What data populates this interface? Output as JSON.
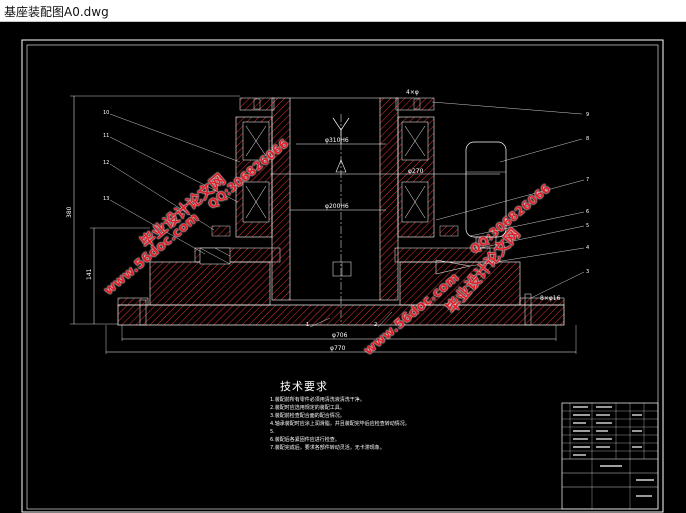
{
  "window": {
    "title": "基座装配图A0.dwg"
  },
  "drawing": {
    "dimensions": {
      "d_top": "φ310H6",
      "d_mid": "φ270",
      "d_inner": "φ200H6",
      "d_base1": "φ706",
      "d_base2": "φ770",
      "h_total": "380",
      "h_side": "141",
      "top_right": "4×φ",
      "bottom_right": "8×φ16"
    },
    "part_numbers": {
      "left": [
        "10",
        "11",
        "12",
        "13"
      ],
      "right": [
        "9",
        "8",
        "7",
        "6",
        "5",
        "4",
        "3"
      ],
      "bottom": [
        "1",
        "2"
      ]
    }
  },
  "technical_requirements": {
    "heading": "技术要求",
    "items": [
      "1.装配前所有零件必须用清洗液清洗干净。",
      "2.装配时应选用规定的装配工具。",
      "3.装配前检查配合面的配合情况。",
      "4.轴承装配时应涂上润滑脂，并且装配完毕后应检查转动情况。",
      "5.",
      "6.装配后各紧固件应进行检查。",
      "7.装配完成后，要求各部件转动灵活，无卡滞现象。"
    ]
  },
  "watermarks": {
    "site": "www.56doc.com",
    "name": "毕业设计论文网",
    "qq": "QQ:306826066"
  }
}
